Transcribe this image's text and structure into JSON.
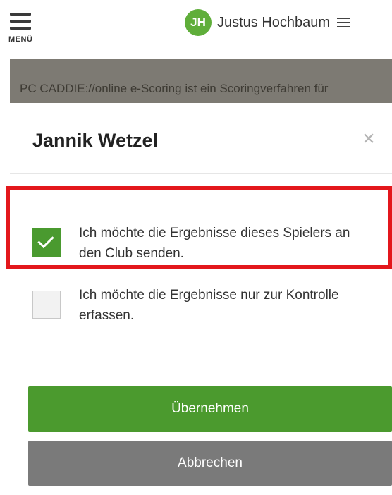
{
  "header": {
    "menu_label": "MENÜ",
    "avatar_initials": "JH",
    "user_name": "Justus Hochbaum"
  },
  "background": {
    "info_text": "PC CADDIE://online e-Scoring ist ein Scoringverfahren für"
  },
  "modal": {
    "title": "Jannik Wetzel",
    "close_symbol": "×",
    "options": [
      {
        "label": "Ich möchte die Ergebnisse dieses Spielers an den Club senden.",
        "checked": true
      },
      {
        "label": "Ich möchte die Ergebnisse nur zur Kontrolle erfassen.",
        "checked": false
      }
    ],
    "confirm_label": "Übernehmen",
    "cancel_label": "Abbrechen"
  },
  "colors": {
    "accent_green": "#4b9a2e",
    "highlight_red": "#e3171c",
    "avatar_green": "#5fae3a",
    "cancel_gray": "#7a7a7a"
  }
}
